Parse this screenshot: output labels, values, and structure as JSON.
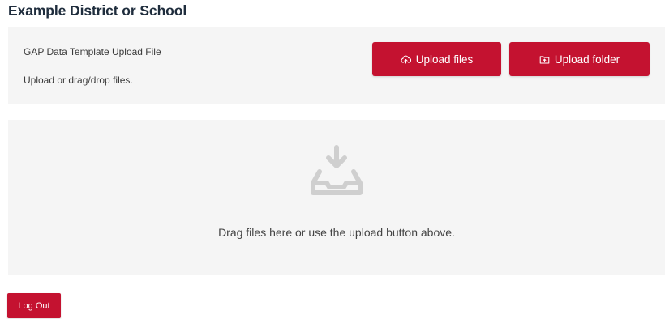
{
  "header": {
    "title": "Example District or School"
  },
  "upload_panel": {
    "label": "GAP Data Template Upload File",
    "hint": "Upload or drag/drop files.",
    "upload_files_label": "Upload files",
    "upload_folder_label": "Upload folder",
    "upload_files_icon": "cloud-upload-icon",
    "upload_folder_icon": "folder-upload-icon"
  },
  "drop_zone": {
    "icon": "inbox-download-icon",
    "message": "Drag files here or use the upload button above."
  },
  "footer": {
    "logout_label": "Log Out"
  },
  "colors": {
    "accent": "#c41230",
    "panel_background": "#f5f5f5",
    "title_text": "#1f2d3d",
    "icon_gray": "#cfcfcf"
  }
}
